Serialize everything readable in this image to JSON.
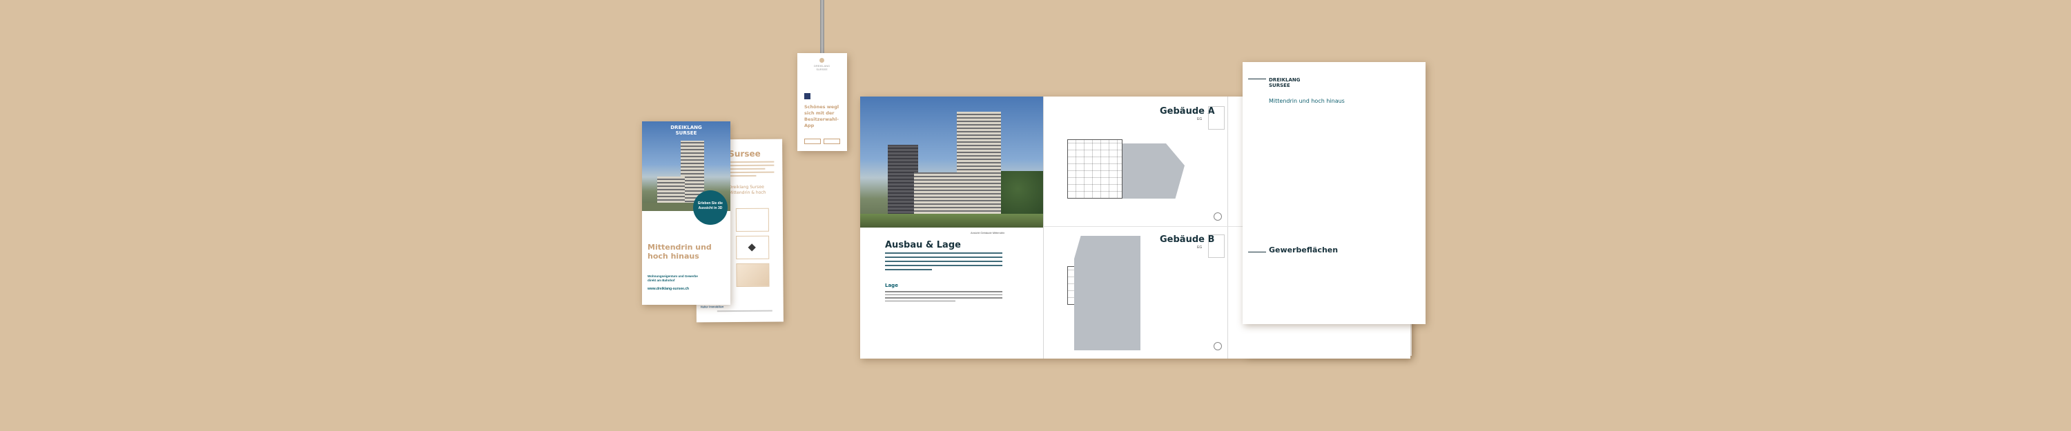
{
  "flyer": {
    "logo_line1": "DREIKLANG",
    "logo_line2": "SURSEE",
    "headline_line1": "Mittendrin und",
    "headline_line2": "hoch hinaus",
    "sub_line1": "Wohnungseigentum und Gewerbe",
    "sub_line2": "direkt am Bahnhof",
    "url": "www.dreiklang-sursee.ch",
    "badge_line1": "Erleben Sie die",
    "badge_line2": "Aussicht in 3D",
    "back_title": "Sursee",
    "back_line1": "Dreiklang Sursee",
    "back_line2": "Mittendrin & hoch",
    "back_logo": "Halter Immobilien"
  },
  "tag": {
    "logo_line1": "DREIKLANG",
    "logo_line2": "SURSEE",
    "text_line1": "Schönes wegl",
    "text_line2": "sich mit der",
    "text_line3": "Besitzerwahl-App"
  },
  "brochure": {
    "caption": "Ansicht Gebäude Mittendrin",
    "section_title": "Ausbau & Lage",
    "lage_label": "Lage",
    "building_a": "Gebäude A",
    "building_b": "Gebäude B",
    "floor_a": "EG",
    "floor_b": "EG"
  },
  "cover": {
    "logo_line1": "DREIKLANG",
    "logo_line2": "SURSEE",
    "tagline": "Mittendrin und hoch hinaus",
    "section": "Gewerbeflächen"
  }
}
